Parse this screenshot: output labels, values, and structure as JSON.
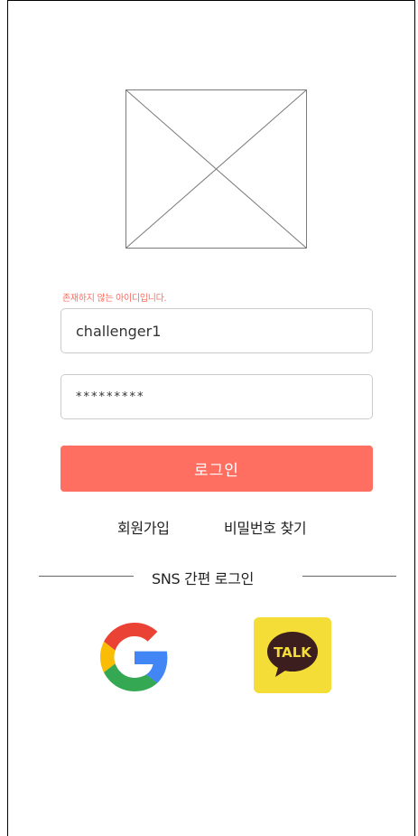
{
  "login": {
    "error_message": "존재하지 않는 아이디입니다.",
    "username_value": "challenger1",
    "password_value": "*********",
    "login_label": "로그인"
  },
  "links": {
    "signup": "회원가입",
    "find_password": "비밀번호 찾기"
  },
  "sns": {
    "section_label": "SNS 간편 로그인",
    "google_icon": "google-logo-icon",
    "kakao_icon": "kakaotalk-logo-icon",
    "kakao_text": "TALK"
  },
  "colors": {
    "accent": "#ff6f61",
    "error": "#ff6b5f",
    "kakao_yellow": "#f4dd36",
    "kakao_bubble": "#3c1e1e",
    "google_blue": "#4285f4",
    "google_red": "#ea4335",
    "google_yellow": "#fbbc05",
    "google_green": "#34a853"
  }
}
